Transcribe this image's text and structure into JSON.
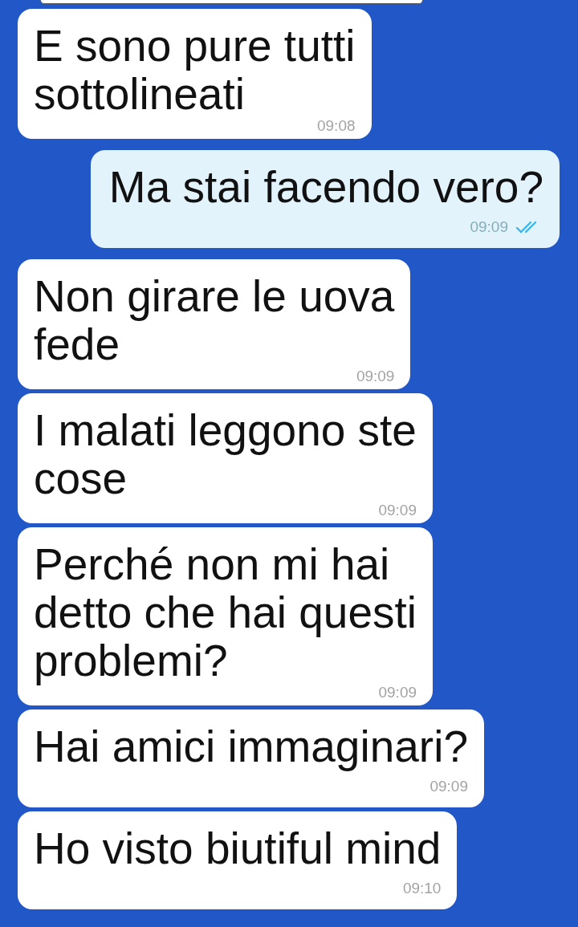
{
  "messages": [
    {
      "kind": "incoming",
      "text": "E sono pure tutti\nsottolineati",
      "time": "09:08"
    },
    {
      "kind": "outgoing",
      "text": "Ma stai facendo vero?",
      "time": "09:09",
      "read": true
    },
    {
      "kind": "incoming",
      "text": "Non girare le uova\nfede",
      "time": "09:09"
    },
    {
      "kind": "incoming",
      "text": "I malati leggono ste\ncose",
      "time": "09:09"
    },
    {
      "kind": "incoming",
      "text": "Perché non mi hai\ndetto che hai questi\nproblemi?",
      "time": "09:09"
    },
    {
      "kind": "incoming",
      "text": "Hai amici immaginari?",
      "time": "09:09"
    },
    {
      "kind": "incoming",
      "text": "Ho visto biutiful mind",
      "time": "09:10"
    }
  ]
}
